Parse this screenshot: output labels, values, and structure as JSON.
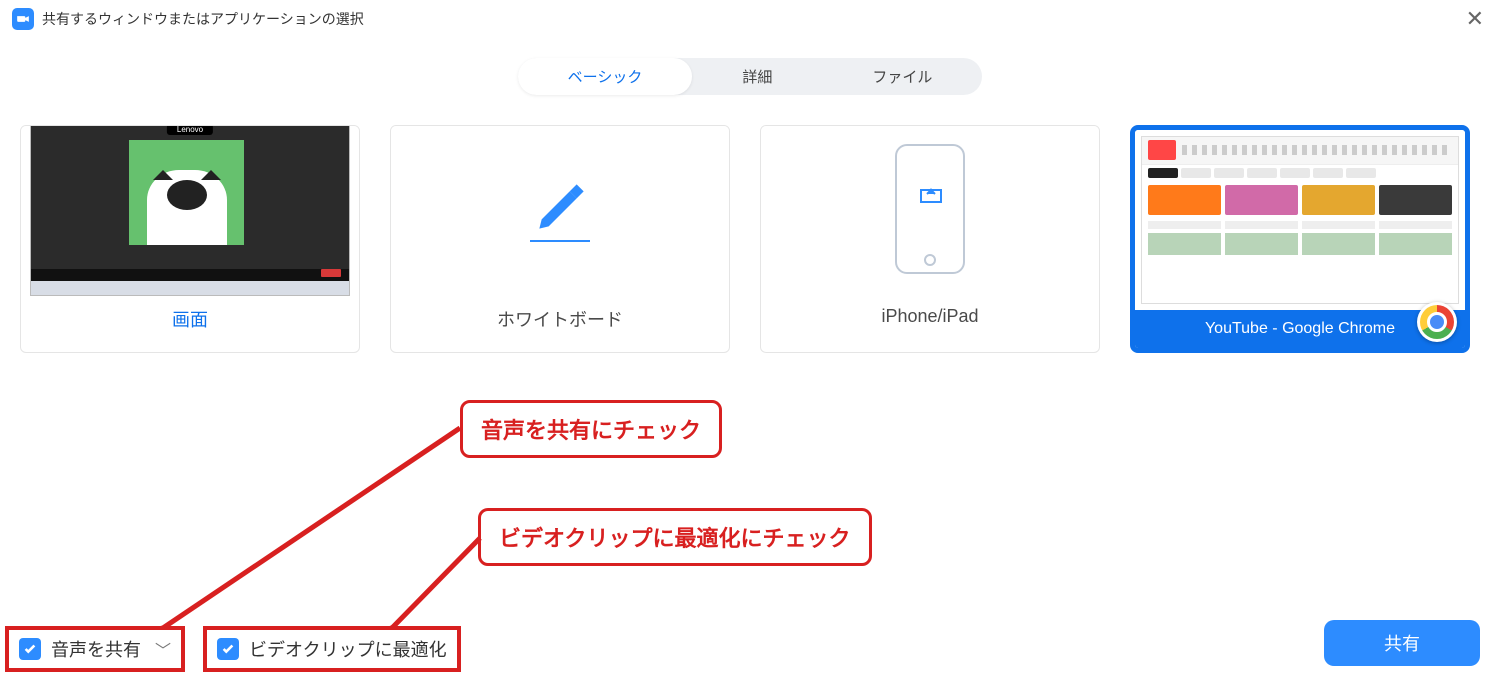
{
  "header": {
    "title": "共有するウィンドウまたはアプリケーションの選択"
  },
  "tabs": {
    "basic": "ベーシック",
    "advanced": "詳細",
    "files": "ファイル"
  },
  "cards": {
    "screen_label": "画面",
    "screen_pill": "Lenovo",
    "whiteboard_label": "ホワイトボード",
    "iphone_label": "iPhone/iPad",
    "chrome_label": "YouTube - Google Chrome"
  },
  "controls": {
    "share_audio": "音声を共有",
    "optimize_video": "ビデオクリップに最適化"
  },
  "annotations": {
    "audio_check": "音声を共有にチェック",
    "video_check": "ビデオクリップに最適化にチェック"
  },
  "buttons": {
    "share": "共有"
  }
}
